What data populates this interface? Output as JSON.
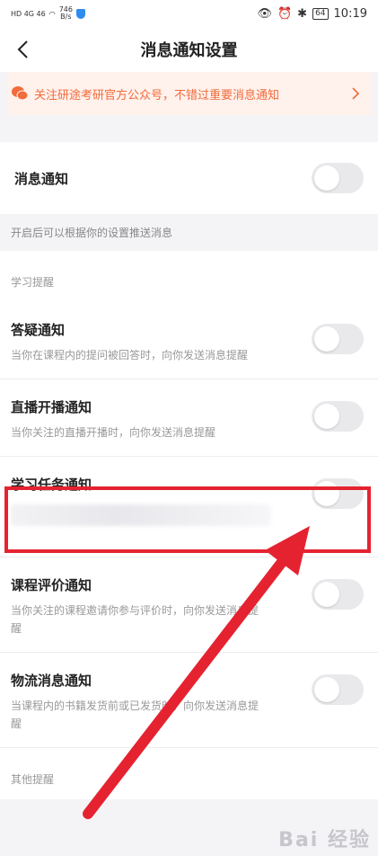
{
  "status": {
    "left": "HD 4G 46 ",
    "speed": "746",
    "speed_unit": "B/s",
    "battery": "64",
    "time": "10:19"
  },
  "nav": {
    "title": "消息通知设置"
  },
  "notice": {
    "text": "关注研途考研官方公众号，不错过重要消息通知"
  },
  "master": {
    "title": "消息通知",
    "hint": "开启后可以根据你的设置推送消息"
  },
  "section_study": "学习提醒",
  "items": [
    {
      "title": "答疑通知",
      "desc": "当你在课程内的提问被回答时，向你发送消息提醒"
    },
    {
      "title": "直播开播通知",
      "desc": "当你关注的直播开播时，向你发送消息提醒"
    },
    {
      "title": "学习任务通知",
      "desc": ""
    },
    {
      "title": "课程评价通知",
      "desc": "当你关注的课程邀请你参与评价时，向你发送消息提醒"
    },
    {
      "title": "物流消息通知",
      "desc": "当课程内的书籍发货前或已发货时，向你发送消息提醒"
    }
  ],
  "section_other": "其他提醒",
  "watermark": "Bai 经验",
  "colors": {
    "accent": "#f26b3a",
    "highlight": "#e52330"
  }
}
